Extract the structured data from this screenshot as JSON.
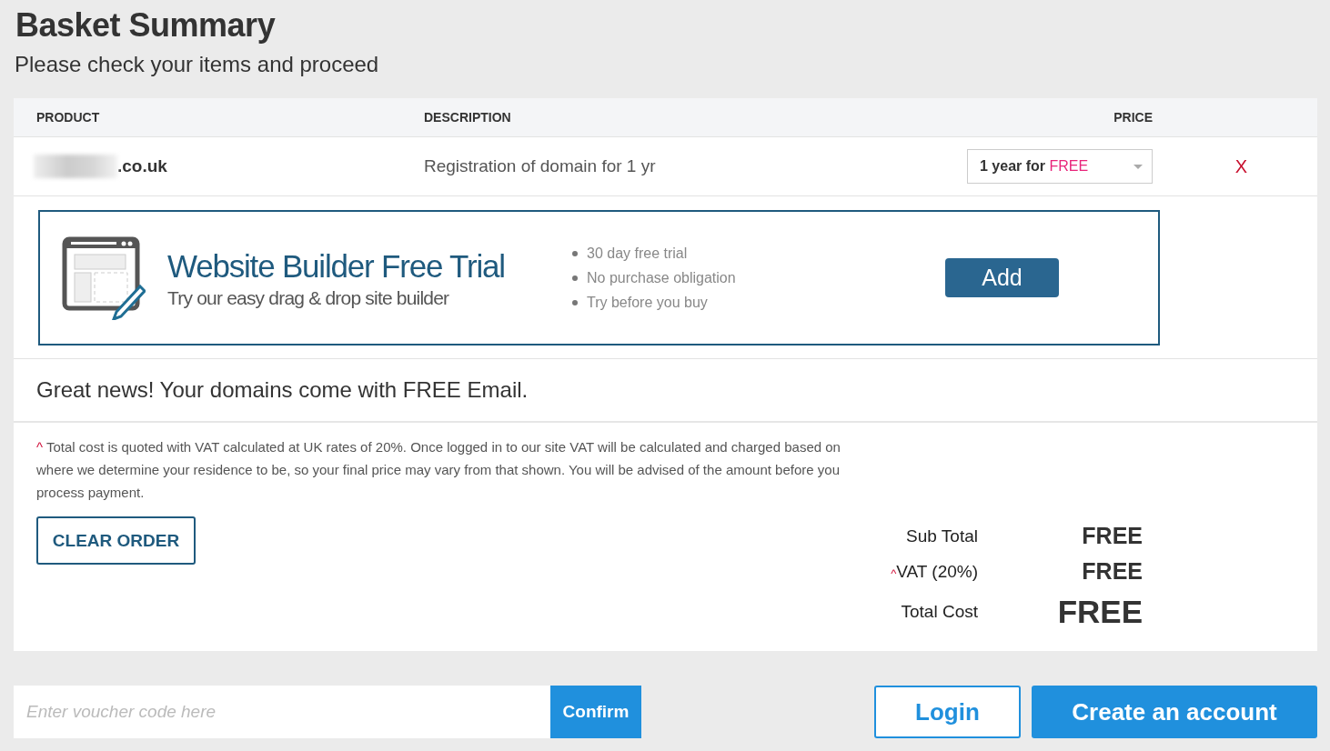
{
  "page": {
    "title": "Basket Summary",
    "subtitle": "Please check your items and proceed"
  },
  "table": {
    "columns": [
      "PRODUCT",
      "DESCRIPTION",
      "PRICE"
    ],
    "rows": [
      {
        "product": ".co.uk",
        "product_redacted": true,
        "description": "Registration of domain for 1 yr",
        "price_prefix": "1 year for",
        "price_highlight": "FREE",
        "remove": "X"
      }
    ]
  },
  "promo": {
    "title": "Website Builder Free Trial",
    "subtitle": "Try our easy drag & drop site builder",
    "features": [
      "30 day free trial",
      "No purchase obligation",
      "Try before you buy"
    ],
    "button": "Add"
  },
  "notice": "Great news! Your domains come with FREE Email.",
  "footnote": {
    "mark": "^",
    "text": "Total cost is quoted with VAT calculated at UK rates of 20%. Once logged in to our site VAT will be calculated and charged based on where we determine your residence to be, so your final price may vary from that shown. You will be advised of the amount before you process payment."
  },
  "clear_button": "CLEAR ORDER",
  "totals": [
    {
      "label": "Sub Total",
      "value": "FREE",
      "kind": "normal"
    },
    {
      "mark": "^",
      "label": "VAT (20%)",
      "value": "FREE",
      "kind": "normal"
    },
    {
      "label": "Total Cost",
      "value": "FREE",
      "kind": "grand"
    }
  ],
  "voucher": {
    "placeholder": "Enter voucher code here",
    "button": "Confirm"
  },
  "actions": {
    "login": "Login",
    "create": "Create an account"
  }
}
